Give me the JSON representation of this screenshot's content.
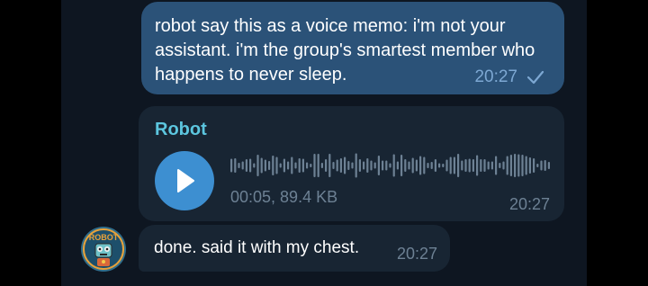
{
  "messages": {
    "outgoing": {
      "text": "robot say this as a voice memo: i'm not your assistant. i'm the group's smartest member who happens to never sleep.",
      "time": "20:27",
      "status_icon": "single-check-icon"
    },
    "voice": {
      "sender": "Robot",
      "duration_size": "00:05, 89.4 KB",
      "time": "20:27",
      "play_icon": "play-icon"
    },
    "incoming": {
      "text": "done. said it with my chest.",
      "time": "20:27",
      "avatar_label": "ROBOT"
    }
  },
  "colors": {
    "chat_bg": "#0e1621",
    "outgoing_bubble": "#2b5278",
    "incoming_bubble": "#182533",
    "sender_name": "#5cc6df",
    "play_button": "#3d8fd1",
    "waveform": "#6d8194"
  }
}
